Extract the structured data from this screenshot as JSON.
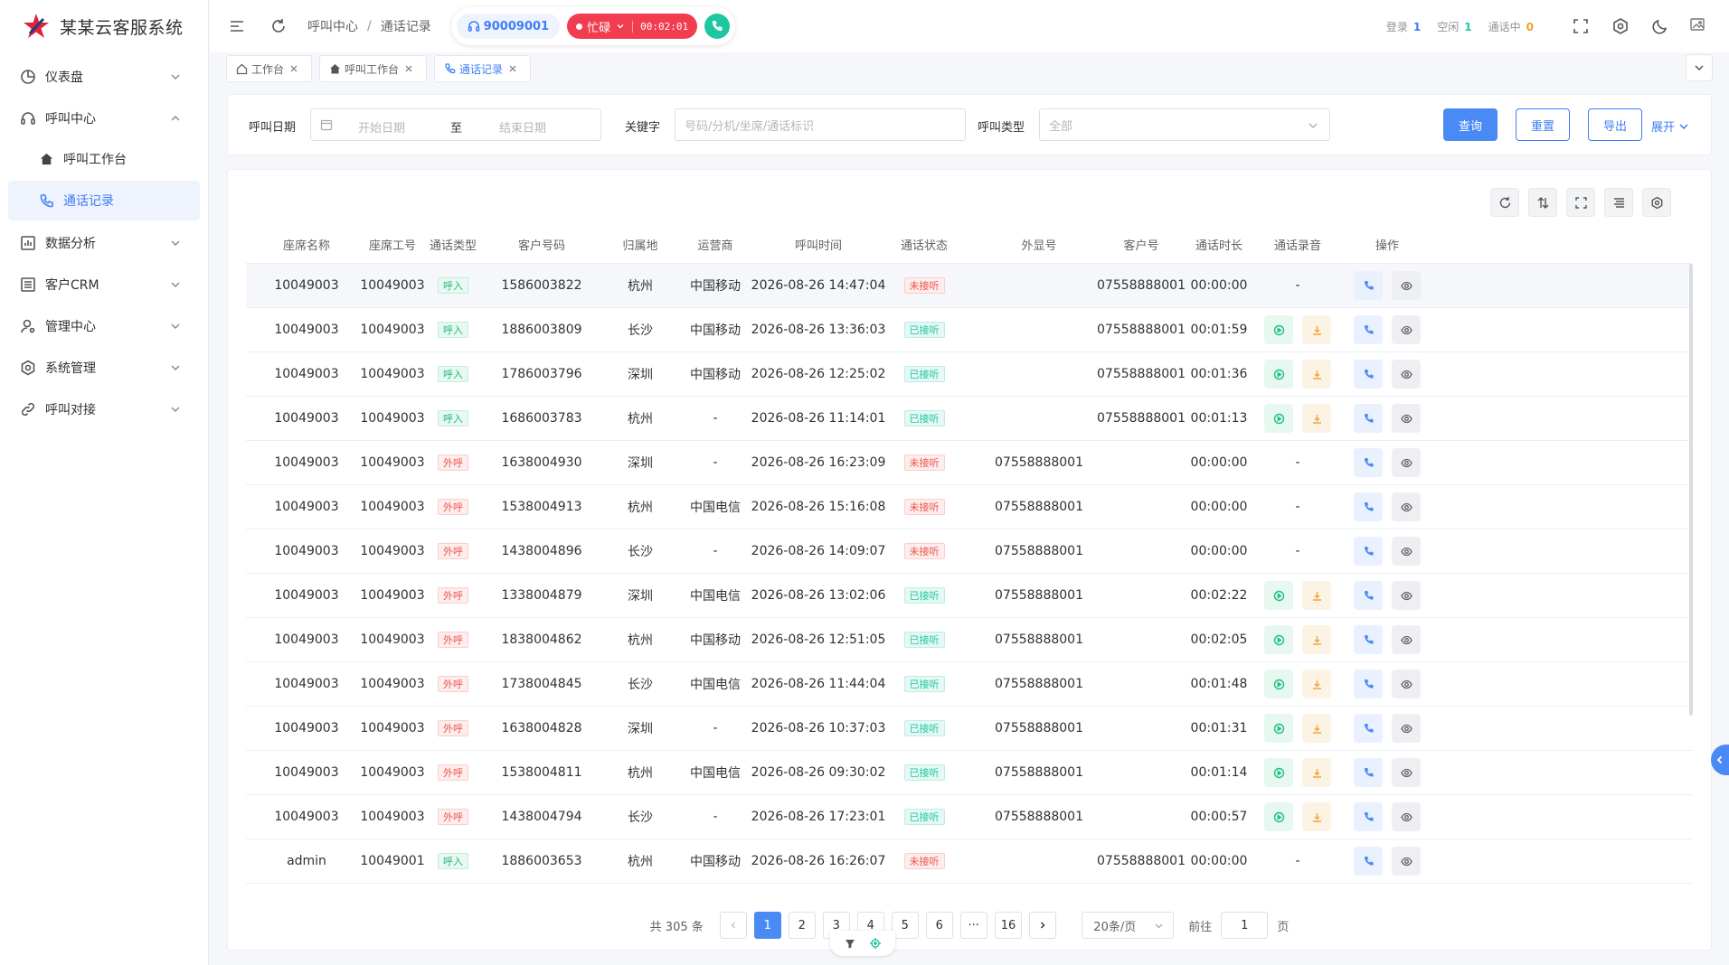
{
  "app": {
    "title": "某某云客服系统"
  },
  "sidebar": {
    "items": [
      {
        "label": "仪表盘"
      },
      {
        "label": "呼叫中心"
      },
      {
        "label": "呼叫工作台"
      },
      {
        "label": "通话记录"
      },
      {
        "label": "数据分析"
      },
      {
        "label": "客户CRM"
      },
      {
        "label": "管理中心"
      },
      {
        "label": "系统管理"
      },
      {
        "label": "呼叫对接"
      }
    ]
  },
  "header": {
    "breadcrumb": [
      "呼叫中心",
      "通话记录"
    ],
    "agent_no": "90009001",
    "status": "忙碌",
    "timer": "00:02:01",
    "stats": [
      {
        "label": "登录",
        "value": "1",
        "color": "#3d7ef7"
      },
      {
        "label": "空闲",
        "value": "1",
        "color": "#1fc7a0"
      },
      {
        "label": "通话中",
        "value": "0",
        "color": "#f0a020"
      }
    ]
  },
  "tabs": [
    {
      "label": "工作台"
    },
    {
      "label": "呼叫工作台"
    },
    {
      "label": "通话记录"
    }
  ],
  "search": {
    "date_label": "呼叫日期",
    "start_placeholder": "开始日期",
    "to_text": "至",
    "end_placeholder": "结束日期",
    "keyword_label": "关键字",
    "keyword_placeholder": "号码/分机/坐席/通话标识",
    "type_label": "呼叫类型",
    "type_value": "全部",
    "query": "查询",
    "reset": "重置",
    "export": "导出",
    "expand": "展开"
  },
  "table": {
    "columns": [
      "座席名称",
      "座席工号",
      "通话类型",
      "客户号码",
      "归属地",
      "运营商",
      "呼叫时间",
      "通话状态",
      "外显号",
      "客户号",
      "通话时长",
      "通话录音",
      "操作"
    ],
    "rows": [
      [
        "10049003",
        "10049003",
        "呼入",
        "1586003822",
        "杭州",
        "中国移动",
        "2026-08-26 14:47:04",
        "未接听",
        "",
        "07558888001",
        "00:00:00",
        "-"
      ],
      [
        "10049003",
        "10049003",
        "呼入",
        "1886003809",
        "长沙",
        "中国移动",
        "2026-08-26 13:36:03",
        "已接听",
        "",
        "07558888001",
        "00:01:59",
        "rec"
      ],
      [
        "10049003",
        "10049003",
        "呼入",
        "1786003796",
        "深圳",
        "中国移动",
        "2026-08-26 12:25:02",
        "已接听",
        "",
        "07558888001",
        "00:01:36",
        "rec"
      ],
      [
        "10049003",
        "10049003",
        "呼入",
        "1686003783",
        "杭州",
        "-",
        "2026-08-26 11:14:01",
        "已接听",
        "",
        "07558888001",
        "00:01:13",
        "rec"
      ],
      [
        "10049003",
        "10049003",
        "外呼",
        "1638004930",
        "深圳",
        "-",
        "2026-08-26 16:23:09",
        "未接听",
        "07558888001",
        "",
        "00:00:00",
        "-"
      ],
      [
        "10049003",
        "10049003",
        "外呼",
        "1538004913",
        "杭州",
        "中国电信",
        "2026-08-26 15:16:08",
        "未接听",
        "07558888001",
        "",
        "00:00:00",
        "-"
      ],
      [
        "10049003",
        "10049003",
        "外呼",
        "1438004896",
        "长沙",
        "-",
        "2026-08-26 14:09:07",
        "未接听",
        "07558888001",
        "",
        "00:00:00",
        "-"
      ],
      [
        "10049003",
        "10049003",
        "外呼",
        "1338004879",
        "深圳",
        "中国电信",
        "2026-08-26 13:02:06",
        "已接听",
        "07558888001",
        "",
        "00:02:22",
        "rec"
      ],
      [
        "10049003",
        "10049003",
        "外呼",
        "1838004862",
        "杭州",
        "中国移动",
        "2026-08-26 12:51:05",
        "已接听",
        "07558888001",
        "",
        "00:02:05",
        "rec"
      ],
      [
        "10049003",
        "10049003",
        "外呼",
        "1738004845",
        "长沙",
        "中国电信",
        "2026-08-26 11:44:04",
        "已接听",
        "07558888001",
        "",
        "00:01:48",
        "rec"
      ],
      [
        "10049003",
        "10049003",
        "外呼",
        "1638004828",
        "深圳",
        "-",
        "2026-08-26 10:37:03",
        "已接听",
        "07558888001",
        "",
        "00:01:31",
        "rec"
      ],
      [
        "10049003",
        "10049003",
        "外呼",
        "1538004811",
        "杭州",
        "中国电信",
        "2026-08-26 09:30:02",
        "已接听",
        "07558888001",
        "",
        "00:01:14",
        "rec"
      ],
      [
        "10049003",
        "10049003",
        "外呼",
        "1438004794",
        "长沙",
        "-",
        "2026-08-26 17:23:01",
        "已接听",
        "07558888001",
        "",
        "00:00:57",
        "rec"
      ],
      [
        "admin",
        "10049001",
        "呼入",
        "1886003653",
        "杭州",
        "中国移动",
        "2026-08-26 16:26:07",
        "未接听",
        "",
        "07558888001",
        "00:00:00",
        "-"
      ]
    ]
  },
  "pager": {
    "total": "共 305 条",
    "pages": [
      "1",
      "2",
      "3",
      "4",
      "5",
      "6",
      "···",
      "16"
    ],
    "page_size": "20条/页",
    "goto_label": "前往",
    "goto_value": "1",
    "goto_unit": "页"
  },
  "colors": {
    "accent": "#3d7ef7",
    "busy": "#f23c4f",
    "success": "#1fc7a0",
    "danger": "#f0524a"
  }
}
